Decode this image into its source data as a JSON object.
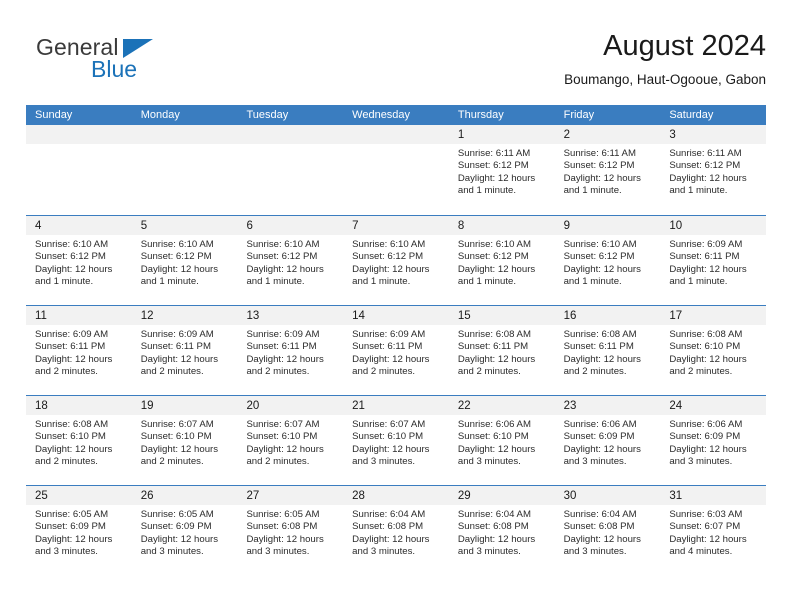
{
  "brand": {
    "word_one": "General",
    "word_two": "Blue",
    "triangle_icon": "triangle-logo-icon",
    "accent_color": "#1b72b8"
  },
  "header": {
    "title": "August 2024",
    "subtitle": "Boumango, Haut-Ogooue, Gabon"
  },
  "calendar": {
    "header_color": "#3a7dc0",
    "day_band_color": "#f2f2f2",
    "weekdays": [
      "Sunday",
      "Monday",
      "Tuesday",
      "Wednesday",
      "Thursday",
      "Friday",
      "Saturday"
    ],
    "weeks": [
      [
        {
          "day": "",
          "empty": true,
          "sunrise": "",
          "sunset": "",
          "daylight": "",
          "daylight_cont": ""
        },
        {
          "day": "",
          "empty": true,
          "sunrise": "",
          "sunset": "",
          "daylight": "",
          "daylight_cont": ""
        },
        {
          "day": "",
          "empty": true,
          "sunrise": "",
          "sunset": "",
          "daylight": "",
          "daylight_cont": ""
        },
        {
          "day": "",
          "empty": true,
          "sunrise": "",
          "sunset": "",
          "daylight": "",
          "daylight_cont": ""
        },
        {
          "day": "1",
          "empty": false,
          "sunrise": "Sunrise: 6:11 AM",
          "sunset": "Sunset: 6:12 PM",
          "daylight": "Daylight: 12 hours",
          "daylight_cont": "and 1 minute."
        },
        {
          "day": "2",
          "empty": false,
          "sunrise": "Sunrise: 6:11 AM",
          "sunset": "Sunset: 6:12 PM",
          "daylight": "Daylight: 12 hours",
          "daylight_cont": "and 1 minute."
        },
        {
          "day": "3",
          "empty": false,
          "sunrise": "Sunrise: 6:11 AM",
          "sunset": "Sunset: 6:12 PM",
          "daylight": "Daylight: 12 hours",
          "daylight_cont": "and 1 minute."
        }
      ],
      [
        {
          "day": "4",
          "empty": false,
          "sunrise": "Sunrise: 6:10 AM",
          "sunset": "Sunset: 6:12 PM",
          "daylight": "Daylight: 12 hours",
          "daylight_cont": "and 1 minute."
        },
        {
          "day": "5",
          "empty": false,
          "sunrise": "Sunrise: 6:10 AM",
          "sunset": "Sunset: 6:12 PM",
          "daylight": "Daylight: 12 hours",
          "daylight_cont": "and 1 minute."
        },
        {
          "day": "6",
          "empty": false,
          "sunrise": "Sunrise: 6:10 AM",
          "sunset": "Sunset: 6:12 PM",
          "daylight": "Daylight: 12 hours",
          "daylight_cont": "and 1 minute."
        },
        {
          "day": "7",
          "empty": false,
          "sunrise": "Sunrise: 6:10 AM",
          "sunset": "Sunset: 6:12 PM",
          "daylight": "Daylight: 12 hours",
          "daylight_cont": "and 1 minute."
        },
        {
          "day": "8",
          "empty": false,
          "sunrise": "Sunrise: 6:10 AM",
          "sunset": "Sunset: 6:12 PM",
          "daylight": "Daylight: 12 hours",
          "daylight_cont": "and 1 minute."
        },
        {
          "day": "9",
          "empty": false,
          "sunrise": "Sunrise: 6:10 AM",
          "sunset": "Sunset: 6:12 PM",
          "daylight": "Daylight: 12 hours",
          "daylight_cont": "and 1 minute."
        },
        {
          "day": "10",
          "empty": false,
          "sunrise": "Sunrise: 6:09 AM",
          "sunset": "Sunset: 6:11 PM",
          "daylight": "Daylight: 12 hours",
          "daylight_cont": "and 1 minute."
        }
      ],
      [
        {
          "day": "11",
          "empty": false,
          "sunrise": "Sunrise: 6:09 AM",
          "sunset": "Sunset: 6:11 PM",
          "daylight": "Daylight: 12 hours",
          "daylight_cont": "and 2 minutes."
        },
        {
          "day": "12",
          "empty": false,
          "sunrise": "Sunrise: 6:09 AM",
          "sunset": "Sunset: 6:11 PM",
          "daylight": "Daylight: 12 hours",
          "daylight_cont": "and 2 minutes."
        },
        {
          "day": "13",
          "empty": false,
          "sunrise": "Sunrise: 6:09 AM",
          "sunset": "Sunset: 6:11 PM",
          "daylight": "Daylight: 12 hours",
          "daylight_cont": "and 2 minutes."
        },
        {
          "day": "14",
          "empty": false,
          "sunrise": "Sunrise: 6:09 AM",
          "sunset": "Sunset: 6:11 PM",
          "daylight": "Daylight: 12 hours",
          "daylight_cont": "and 2 minutes."
        },
        {
          "day": "15",
          "empty": false,
          "sunrise": "Sunrise: 6:08 AM",
          "sunset": "Sunset: 6:11 PM",
          "daylight": "Daylight: 12 hours",
          "daylight_cont": "and 2 minutes."
        },
        {
          "day": "16",
          "empty": false,
          "sunrise": "Sunrise: 6:08 AM",
          "sunset": "Sunset: 6:11 PM",
          "daylight": "Daylight: 12 hours",
          "daylight_cont": "and 2 minutes."
        },
        {
          "day": "17",
          "empty": false,
          "sunrise": "Sunrise: 6:08 AM",
          "sunset": "Sunset: 6:10 PM",
          "daylight": "Daylight: 12 hours",
          "daylight_cont": "and 2 minutes."
        }
      ],
      [
        {
          "day": "18",
          "empty": false,
          "sunrise": "Sunrise: 6:08 AM",
          "sunset": "Sunset: 6:10 PM",
          "daylight": "Daylight: 12 hours",
          "daylight_cont": "and 2 minutes."
        },
        {
          "day": "19",
          "empty": false,
          "sunrise": "Sunrise: 6:07 AM",
          "sunset": "Sunset: 6:10 PM",
          "daylight": "Daylight: 12 hours",
          "daylight_cont": "and 2 minutes."
        },
        {
          "day": "20",
          "empty": false,
          "sunrise": "Sunrise: 6:07 AM",
          "sunset": "Sunset: 6:10 PM",
          "daylight": "Daylight: 12 hours",
          "daylight_cont": "and 2 minutes."
        },
        {
          "day": "21",
          "empty": false,
          "sunrise": "Sunrise: 6:07 AM",
          "sunset": "Sunset: 6:10 PM",
          "daylight": "Daylight: 12 hours",
          "daylight_cont": "and 3 minutes."
        },
        {
          "day": "22",
          "empty": false,
          "sunrise": "Sunrise: 6:06 AM",
          "sunset": "Sunset: 6:10 PM",
          "daylight": "Daylight: 12 hours",
          "daylight_cont": "and 3 minutes."
        },
        {
          "day": "23",
          "empty": false,
          "sunrise": "Sunrise: 6:06 AM",
          "sunset": "Sunset: 6:09 PM",
          "daylight": "Daylight: 12 hours",
          "daylight_cont": "and 3 minutes."
        },
        {
          "day": "24",
          "empty": false,
          "sunrise": "Sunrise: 6:06 AM",
          "sunset": "Sunset: 6:09 PM",
          "daylight": "Daylight: 12 hours",
          "daylight_cont": "and 3 minutes."
        }
      ],
      [
        {
          "day": "25",
          "empty": false,
          "sunrise": "Sunrise: 6:05 AM",
          "sunset": "Sunset: 6:09 PM",
          "daylight": "Daylight: 12 hours",
          "daylight_cont": "and 3 minutes."
        },
        {
          "day": "26",
          "empty": false,
          "sunrise": "Sunrise: 6:05 AM",
          "sunset": "Sunset: 6:09 PM",
          "daylight": "Daylight: 12 hours",
          "daylight_cont": "and 3 minutes."
        },
        {
          "day": "27",
          "empty": false,
          "sunrise": "Sunrise: 6:05 AM",
          "sunset": "Sunset: 6:08 PM",
          "daylight": "Daylight: 12 hours",
          "daylight_cont": "and 3 minutes."
        },
        {
          "day": "28",
          "empty": false,
          "sunrise": "Sunrise: 6:04 AM",
          "sunset": "Sunset: 6:08 PM",
          "daylight": "Daylight: 12 hours",
          "daylight_cont": "and 3 minutes."
        },
        {
          "day": "29",
          "empty": false,
          "sunrise": "Sunrise: 6:04 AM",
          "sunset": "Sunset: 6:08 PM",
          "daylight": "Daylight: 12 hours",
          "daylight_cont": "and 3 minutes."
        },
        {
          "day": "30",
          "empty": false,
          "sunrise": "Sunrise: 6:04 AM",
          "sunset": "Sunset: 6:08 PM",
          "daylight": "Daylight: 12 hours",
          "daylight_cont": "and 3 minutes."
        },
        {
          "day": "31",
          "empty": false,
          "sunrise": "Sunrise: 6:03 AM",
          "sunset": "Sunset: 6:07 PM",
          "daylight": "Daylight: 12 hours",
          "daylight_cont": "and 4 minutes."
        }
      ]
    ]
  }
}
